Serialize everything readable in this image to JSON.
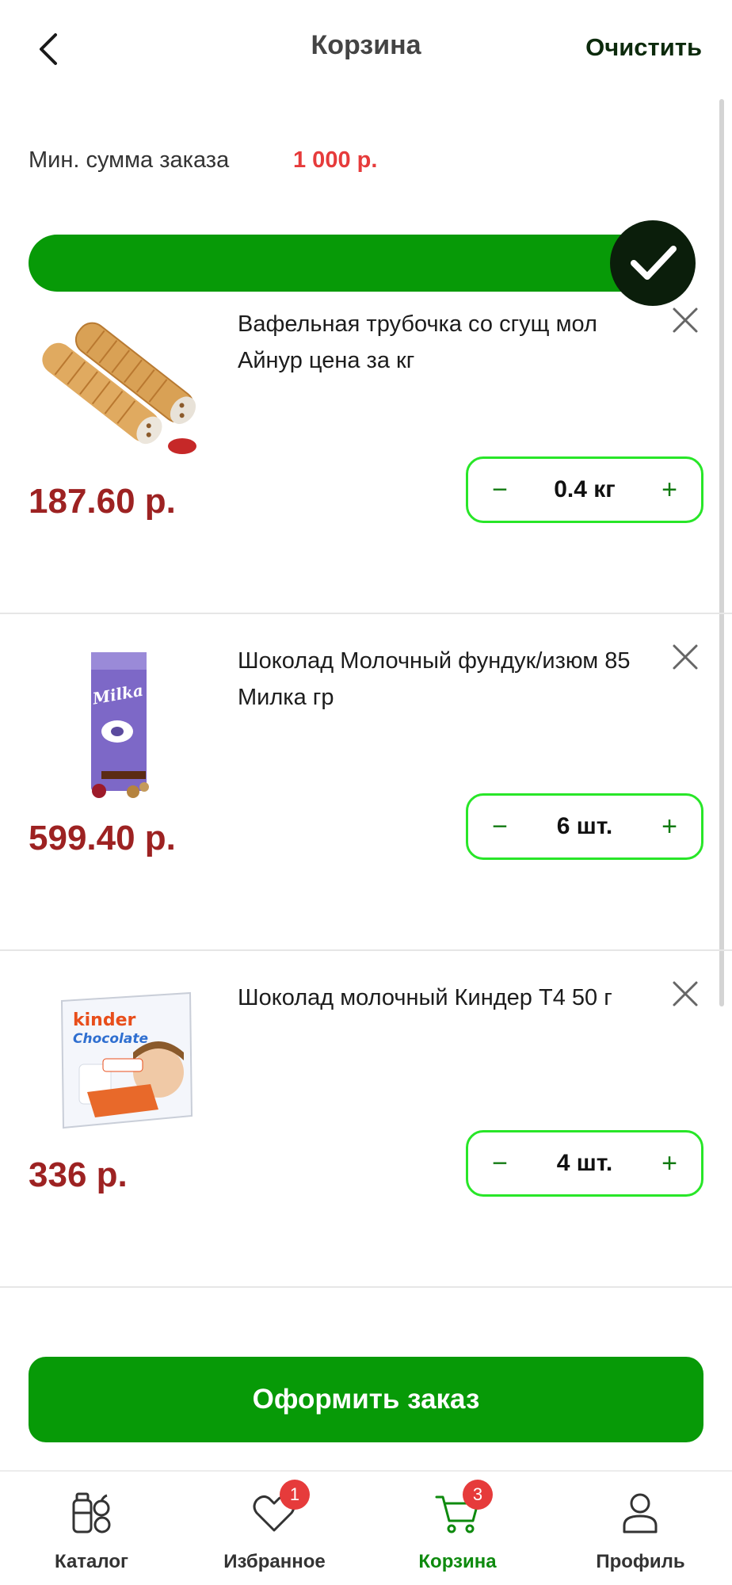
{
  "header": {
    "title": "Корзина",
    "clear_label": "Очистить"
  },
  "min_order": {
    "label": "Мин. сумма заказа",
    "value": "1 000 р."
  },
  "progress": {
    "fraction": 1.0
  },
  "cart_items": [
    {
      "name": "Вафельная трубочка со сгущ мол Айнур цена за кг",
      "price": "187.60 р.",
      "quantity": "0.4 кг",
      "image": "wafer-rolls-image"
    },
    {
      "name": "Шоколад Молочный фундук/изюм 85 Милка гр",
      "price": "599.40 р.",
      "quantity": "6 шт.",
      "image": "milka-chocolate-image"
    },
    {
      "name": "Шоколад молочный Киндер Т4 50 г",
      "price": "336 р.",
      "quantity": "4 шт.",
      "image": "kinder-chocolate-image",
      "image_text_brand": "kinder",
      "image_text_product": "Chocolate"
    }
  ],
  "stepper": {
    "minus": "−",
    "plus": "+"
  },
  "checkout": {
    "label": "Оформить заказ"
  },
  "nav": {
    "items": [
      {
        "label": "Каталог",
        "icon": "catalog-icon",
        "active": false
      },
      {
        "label": "Избранное",
        "icon": "heart-icon",
        "active": false,
        "badge": "1"
      },
      {
        "label": "Корзина",
        "icon": "cart-icon",
        "active": true,
        "badge": "3"
      },
      {
        "label": "Профиль",
        "icon": "profile-icon",
        "active": false
      }
    ]
  },
  "colors": {
    "accent_green": "#079a07",
    "price_red": "#9d2222",
    "min_sum_red": "#e63b3b",
    "stepper_border": "#28e628",
    "badge_red": "#e63b3b"
  }
}
